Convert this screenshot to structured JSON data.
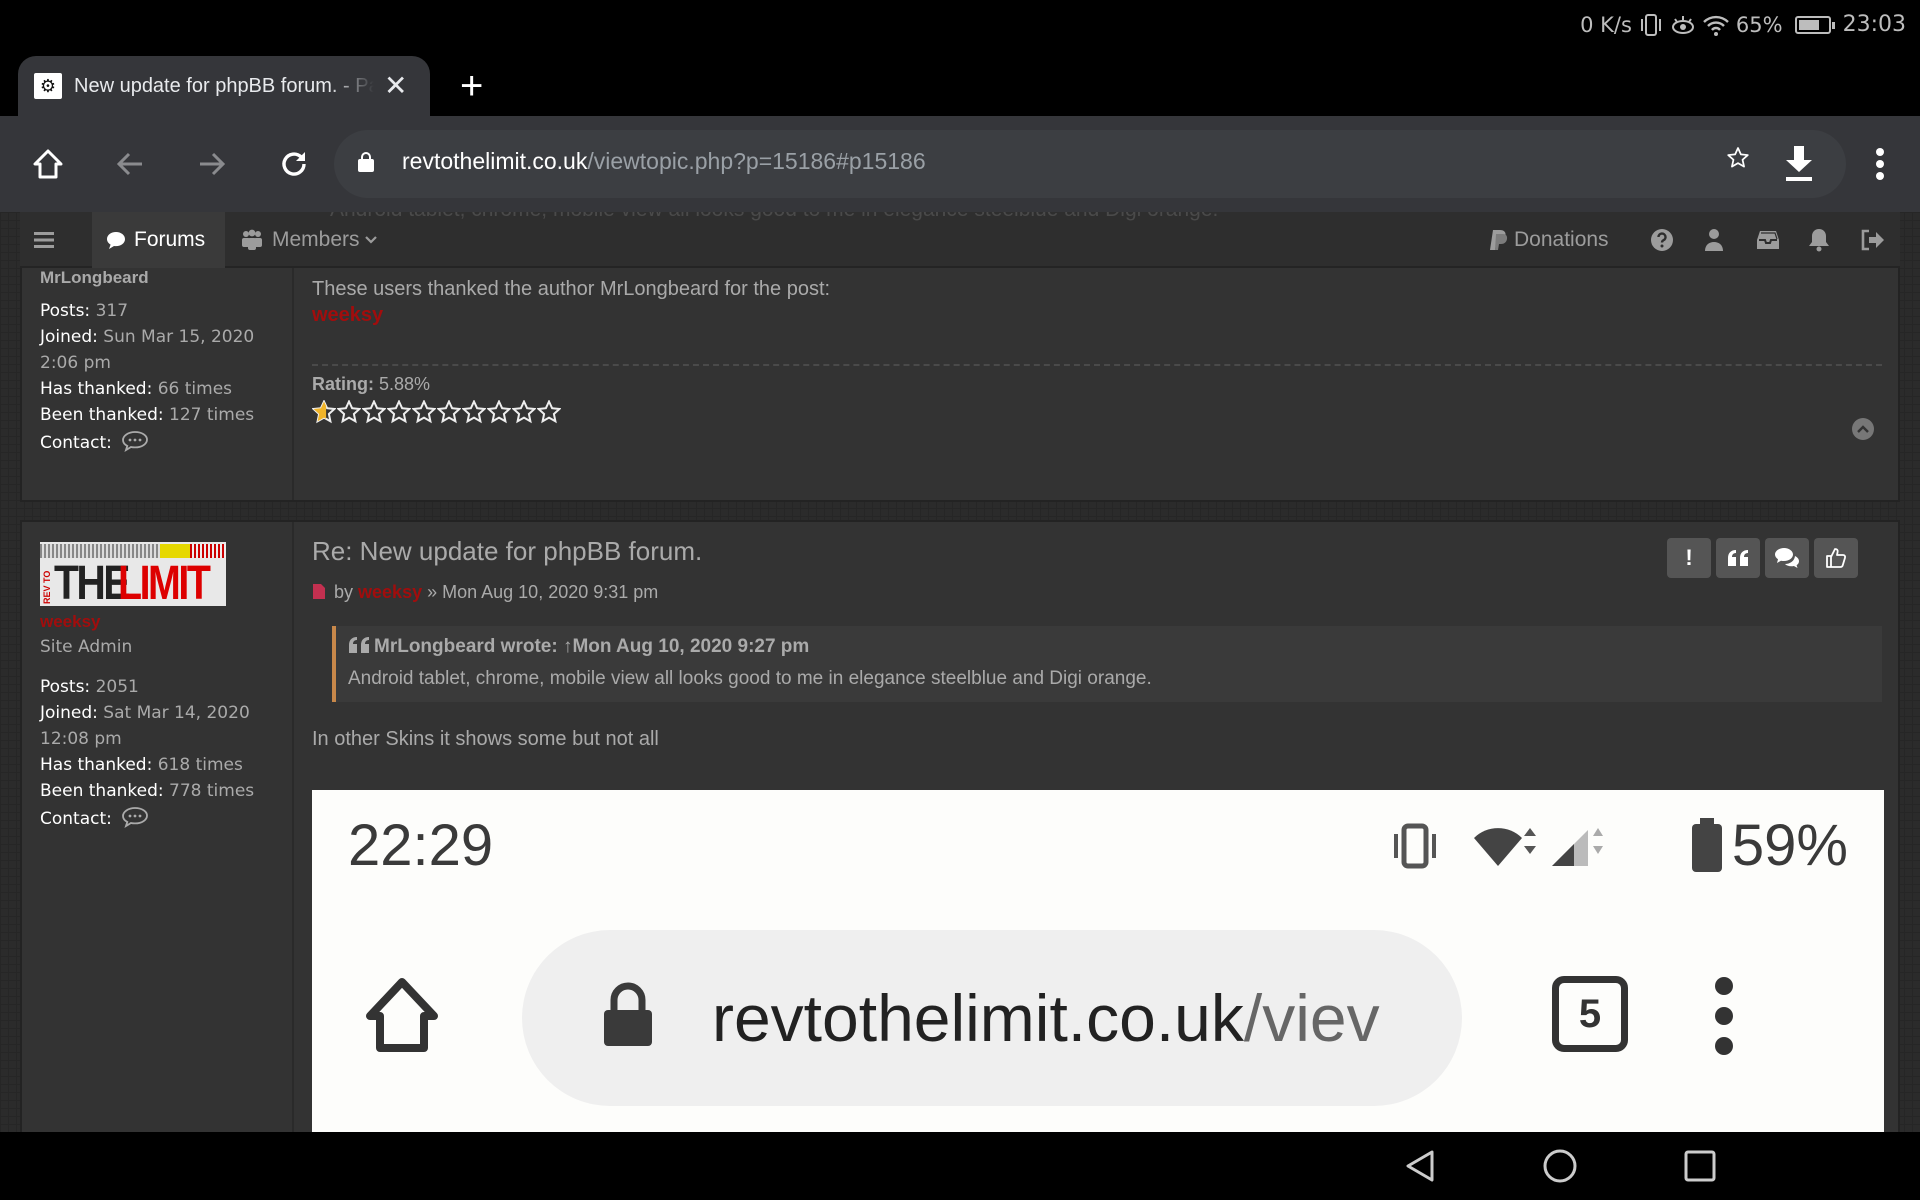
{
  "status_bar": {
    "net_speed": "0 K/s",
    "battery_pct": "65%",
    "battery_level": 0.65,
    "time": "23:03",
    "icons": [
      "vibrate-icon",
      "eye-comfort-icon",
      "wifi-icon",
      "battery-icon"
    ]
  },
  "browser": {
    "tab": {
      "title": "New update for phpBB forum. - Pa",
      "close_label": "✕"
    },
    "new_tab_label": "+",
    "url_domain": "revtothelimit.co.uk",
    "url_path": "/viewtopic.php?p=15186#p15186"
  },
  "navbar": {
    "ghost_text": "Android tablet, chrome, mobile view all looks good to me in elegance steelblue and Digi orange.",
    "forums_label": "Forums",
    "members_label": "Members",
    "donations_label": "Donations"
  },
  "post1": {
    "username": "MrLongbeard",
    "stats": [
      {
        "label": "Posts:",
        "value": "317"
      },
      {
        "label": "Joined:",
        "value": "Sun Mar 15, 2020"
      },
      {
        "label": "",
        "value": "2:06 pm"
      },
      {
        "label": "Has thanked:",
        "value": "66 times"
      },
      {
        "label": "Been thanked:",
        "value": "127 times"
      }
    ],
    "contact_label": "Contact:",
    "thanks_text": "These users thanked the author MrLongbeard for the post:",
    "thanked_by": "weeksy",
    "rating_label": "Rating:",
    "rating_value": "5.88%",
    "rating_fraction": 0.0588,
    "star_count": 10
  },
  "post2": {
    "username": "weeksy",
    "rank": "Site Admin",
    "avatar_text_left": "REV TO",
    "avatar_text_the": "THE",
    "avatar_text_limit": "LIMIT",
    "stats": [
      {
        "label": "Posts:",
        "value": "2051"
      },
      {
        "label": "Joined:",
        "value": "Sat Mar 14, 2020"
      },
      {
        "label": "",
        "value": "12:08 pm"
      },
      {
        "label": "Has thanked:",
        "value": "618 times"
      },
      {
        "label": "Been thanked:",
        "value": "778 times"
      }
    ],
    "contact_label": "Contact:",
    "title": "Re: New update for phpBB forum.",
    "by_label": "by",
    "author": "weeksy",
    "date": "» Mon Aug 10, 2020 9:31 pm",
    "quote_head": "MrLongbeard wrote: ↑Mon Aug 10, 2020 9:27 pm",
    "quote_body": "Android tablet, chrome, mobile view all looks good to me in elegance steelblue and Digi orange.",
    "body": "In other Skins it shows some but not all",
    "actions": [
      "report-button",
      "quote-button",
      "pm-button",
      "like-button"
    ],
    "embedded_screenshot": {
      "time": "22:29",
      "battery": "59%",
      "url_domain": "revtothelimit.co.uk",
      "url_path": "/viev",
      "tab_count": "5"
    }
  },
  "colors": {
    "accent_red": "#a10d0d",
    "quote_border": "#c8884a",
    "panel_bg": "#333333"
  }
}
